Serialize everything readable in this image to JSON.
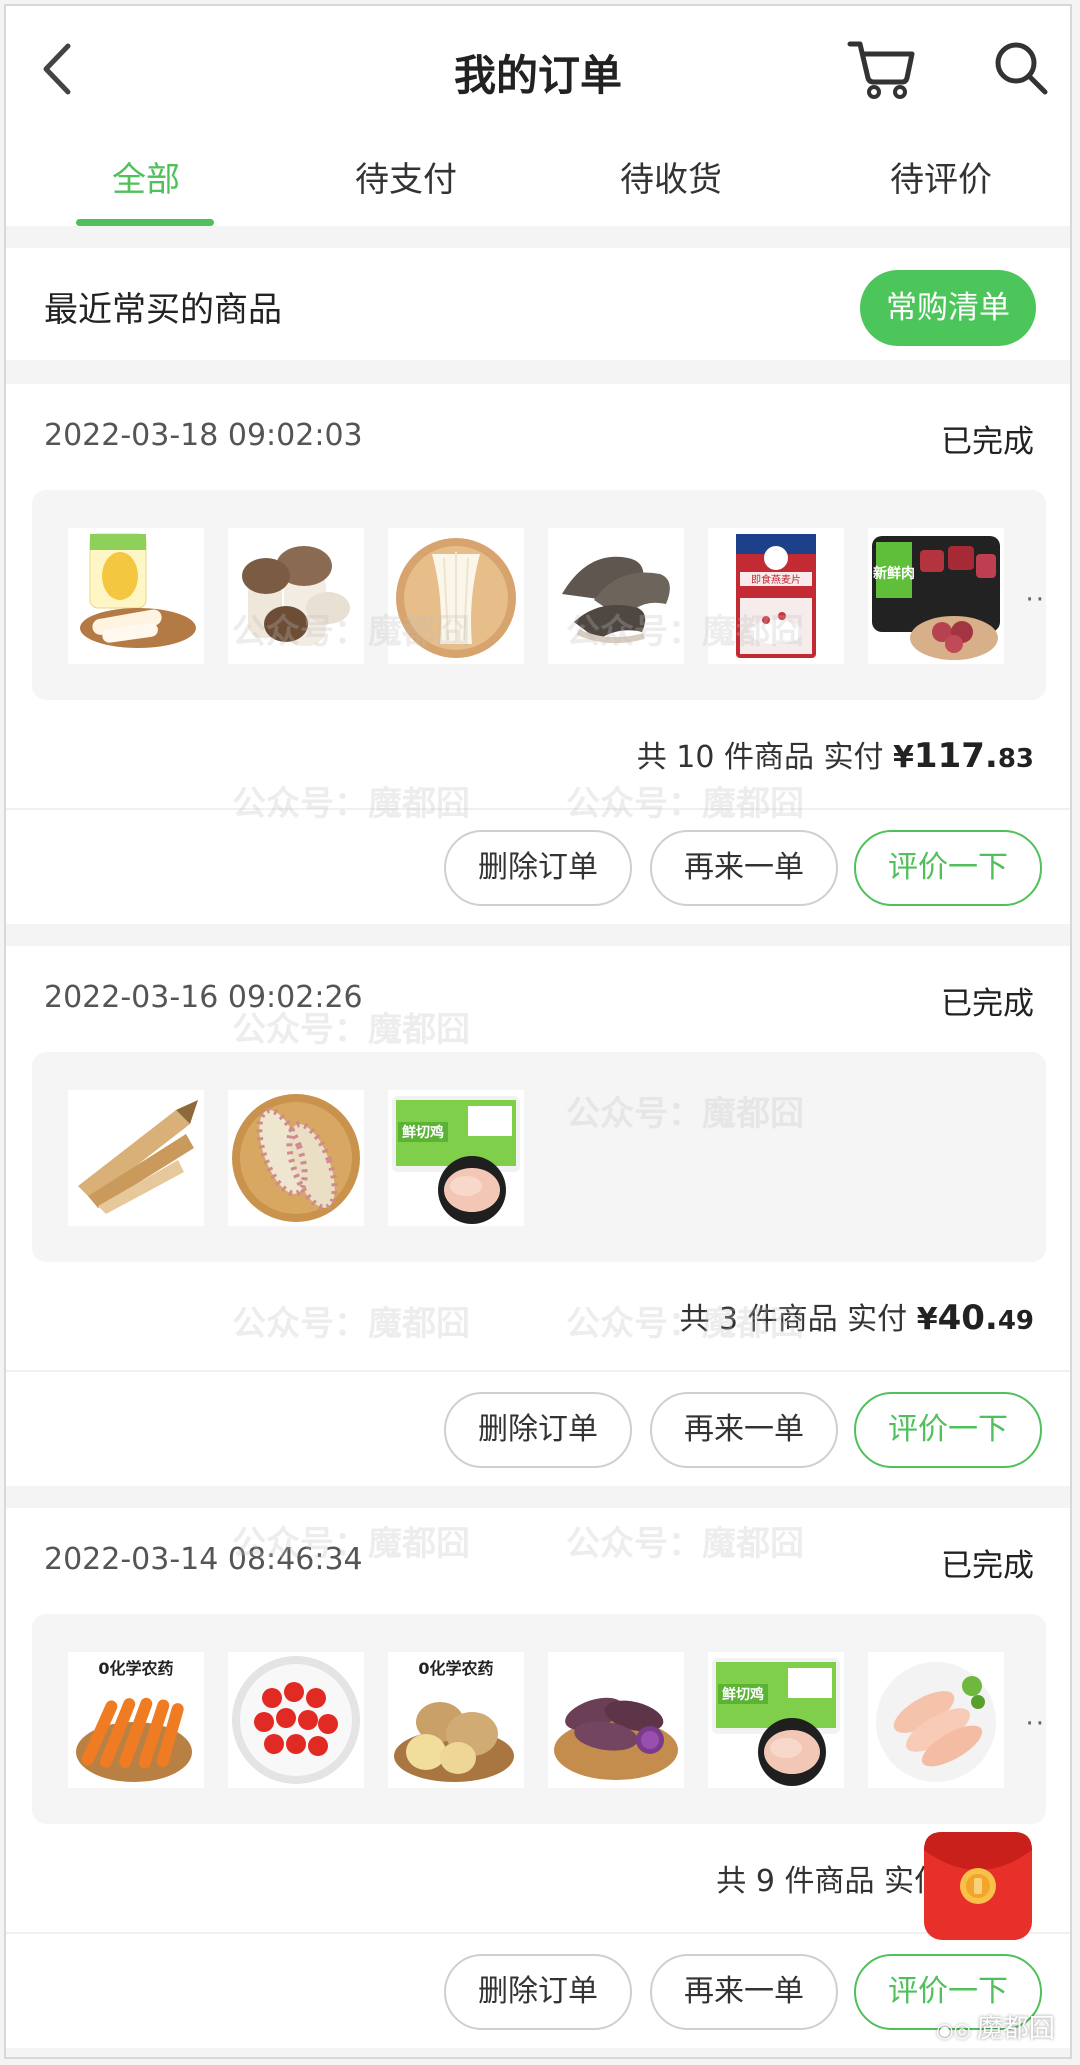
{
  "header": {
    "title": "我的订单",
    "back_icon": "chevron-left-icon",
    "cart_icon": "cart-icon",
    "search_icon": "search-icon"
  },
  "tabs": [
    {
      "label": "全部",
      "active": true
    },
    {
      "label": "待支付",
      "active": false
    },
    {
      "label": "待收货",
      "active": false
    },
    {
      "label": "待评价",
      "active": false
    }
  ],
  "recent": {
    "title": "最近常买的商品",
    "button": "常购清单"
  },
  "orders": [
    {
      "date": "2022-03-18 09:02:03",
      "status": "已完成",
      "goods": [
        "bamboo-shoot-corn",
        "king-oyster-mushroom",
        "enoki-mushroom",
        "oyster-mushroom",
        "oatmeal-pack",
        "fresh-pork"
      ],
      "has_more": true,
      "count_text": "共 10 件商品 实付",
      "price_yen": "¥",
      "price_int": "117.",
      "price_dec": "83",
      "buttons": {
        "delete": "删除订单",
        "again": "再来一单",
        "rate": "评价一下"
      }
    },
    {
      "date": "2022-03-16 09:02:26",
      "status": "已完成",
      "goods": [
        "bamboo-shoots",
        "corn",
        "chicken-breast"
      ],
      "has_more": false,
      "count_text": "共 3 件商品 实付",
      "price_yen": "¥",
      "price_int": "40.",
      "price_dec": "49",
      "buttons": {
        "delete": "删除订单",
        "again": "再来一单",
        "rate": "评价一下"
      }
    },
    {
      "date": "2022-03-14 08:46:34",
      "status": "已完成",
      "goods": [
        "carrot",
        "cherry-tomato",
        "potato",
        "purple-sweet-potato",
        "chicken-breast",
        "chicken-fillet"
      ],
      "has_more": true,
      "count_text": "共 9 件商品 实付",
      "price_yen": "",
      "price_int": "",
      "price_dec": "",
      "buttons": {
        "delete": "删除订单",
        "again": "再来一单",
        "rate": "评价一下"
      }
    }
  ],
  "product_labels": {
    "zero_pesticide": "0化学农药",
    "fresh_chicken": "鲜切鸡",
    "fresh_meat": "新鲜肉",
    "oatmeal": "即食燕麦片"
  },
  "more_dots": "··",
  "watermark": "公众号：魔都囧",
  "brand_mark": "魔都囧",
  "colors": {
    "accent": "#4fc05a",
    "red_packet": "#e8302b"
  }
}
